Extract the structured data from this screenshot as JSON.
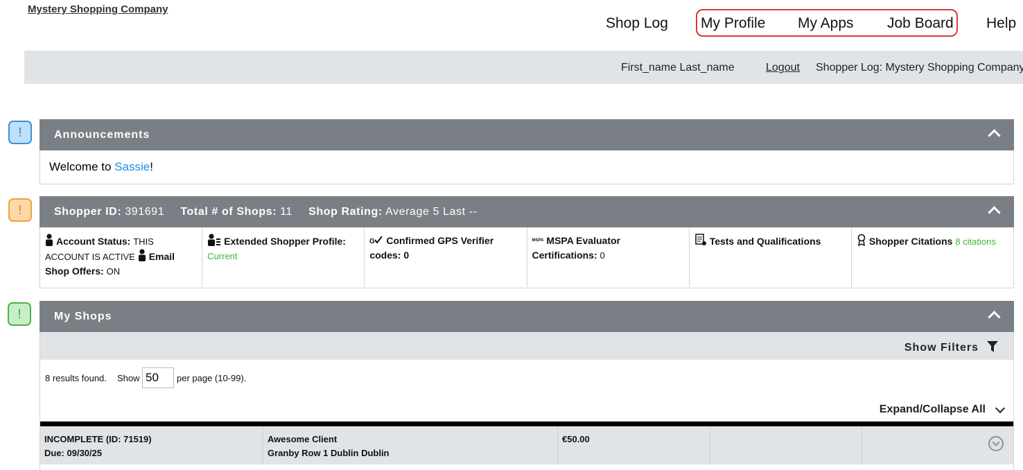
{
  "brand": "Mystery Shopping Company",
  "nav": {
    "shop_log": "Shop Log",
    "my_profile": "My Profile",
    "my_apps": "My Apps",
    "job_board": "Job Board",
    "help": "Help"
  },
  "userbar": {
    "user_name": "First_name Last_name",
    "logout": "Logout",
    "log_label": "Shopper Log: Mystery Shopping Company"
  },
  "markers": {
    "symbol": "!"
  },
  "announcements": {
    "title": "Announcements",
    "welcome_prefix": "Welcome to ",
    "welcome_link": "Sassie",
    "welcome_suffix": "!"
  },
  "shopper": {
    "id_label": "Shopper ID:",
    "id_value": "391691",
    "total_label": "Total # of Shops:",
    "total_value": "11",
    "rating_label": "Shop Rating:",
    "rating_value": "Average 5  Last --",
    "cells": {
      "account_status_label": "Account Status:",
      "account_status_value": "THIS ACCOUNT IS ACTIVE",
      "email_label": "Email Shop Offers:",
      "email_value": "ON",
      "extended_label": "Extended Shopper Profile:",
      "extended_value": "Current",
      "gps_label": "Confirmed GPS Verifier codes:",
      "gps_value": "0",
      "mspa_badge": "MSPA",
      "mspa_label": "MSPA Evaluator Certifications:",
      "mspa_value": "0",
      "tests_label": "Tests and Qualifications",
      "citations_label": "Shopper Citations",
      "citations_value": "8 citations"
    }
  },
  "myshops": {
    "title": "My Shops",
    "show_filters": "Show Filters",
    "results": "8 results found.",
    "show": "Show",
    "per_page_value": "50",
    "per_page_text": "per page (10-99).",
    "expand_all": "Expand/Collapse All",
    "rows": [
      {
        "status": "INCOMPLETE (ID: 71519)",
        "due": "Due: 09/30/25",
        "client": "Awesome Client",
        "address": "Granby Row 1 Dublin Dublin",
        "amount": "€50.00"
      }
    ]
  },
  "colors": {
    "panel_header": "#7a7e85",
    "bar_gray": "#e1e4e7",
    "nav_highlight": "#d93a3a",
    "link_blue": "#1b8fe0",
    "status_green": "#3bb53b"
  }
}
